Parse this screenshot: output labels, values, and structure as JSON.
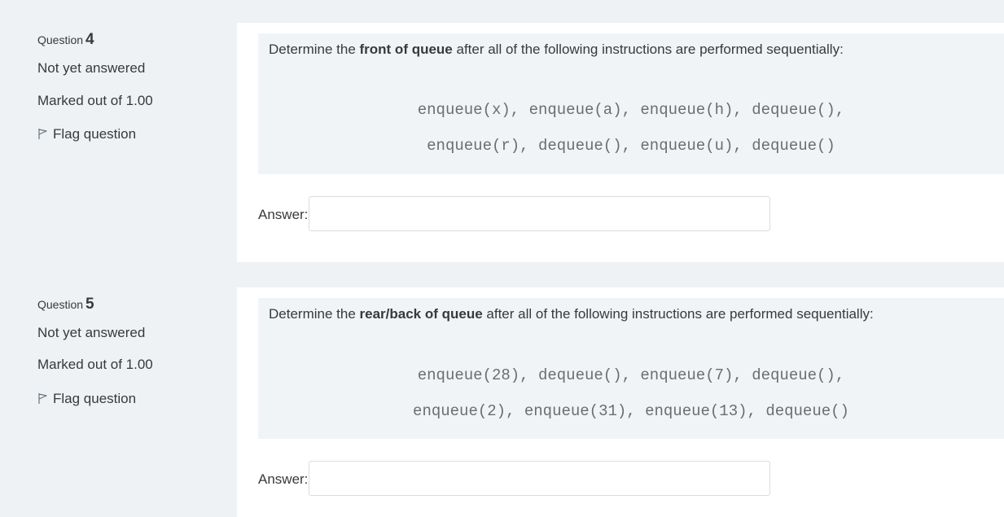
{
  "questions": [
    {
      "label": "Question",
      "number": "4",
      "state": "Not yet answered",
      "grade": "Marked out of 1.00",
      "flag_label": "Flag question",
      "text_prefix": "Determine the ",
      "text_bold": "front of queue",
      "text_suffix": " after all of the following instructions are performed sequentially:",
      "code_lines": [
        "enqueue(x), enqueue(a), enqueue(h), dequeue(),",
        "enqueue(r), dequeue(), enqueue(u), dequeue()"
      ],
      "answer_label": "Answer:",
      "answer_value": ""
    },
    {
      "label": "Question",
      "number": "5",
      "state": "Not yet answered",
      "grade": "Marked out of 1.00",
      "flag_label": "Flag question",
      "text_prefix": "Determine the ",
      "text_bold": "rear/back of queue",
      "text_suffix": " after all of the following instructions are performed sequentially:",
      "code_lines": [
        "enqueue(28), dequeue(), enqueue(7), dequeue(),",
        "enqueue(2), enqueue(31), enqueue(13), dequeue()"
      ],
      "answer_label": "Answer:",
      "answer_value": ""
    }
  ]
}
